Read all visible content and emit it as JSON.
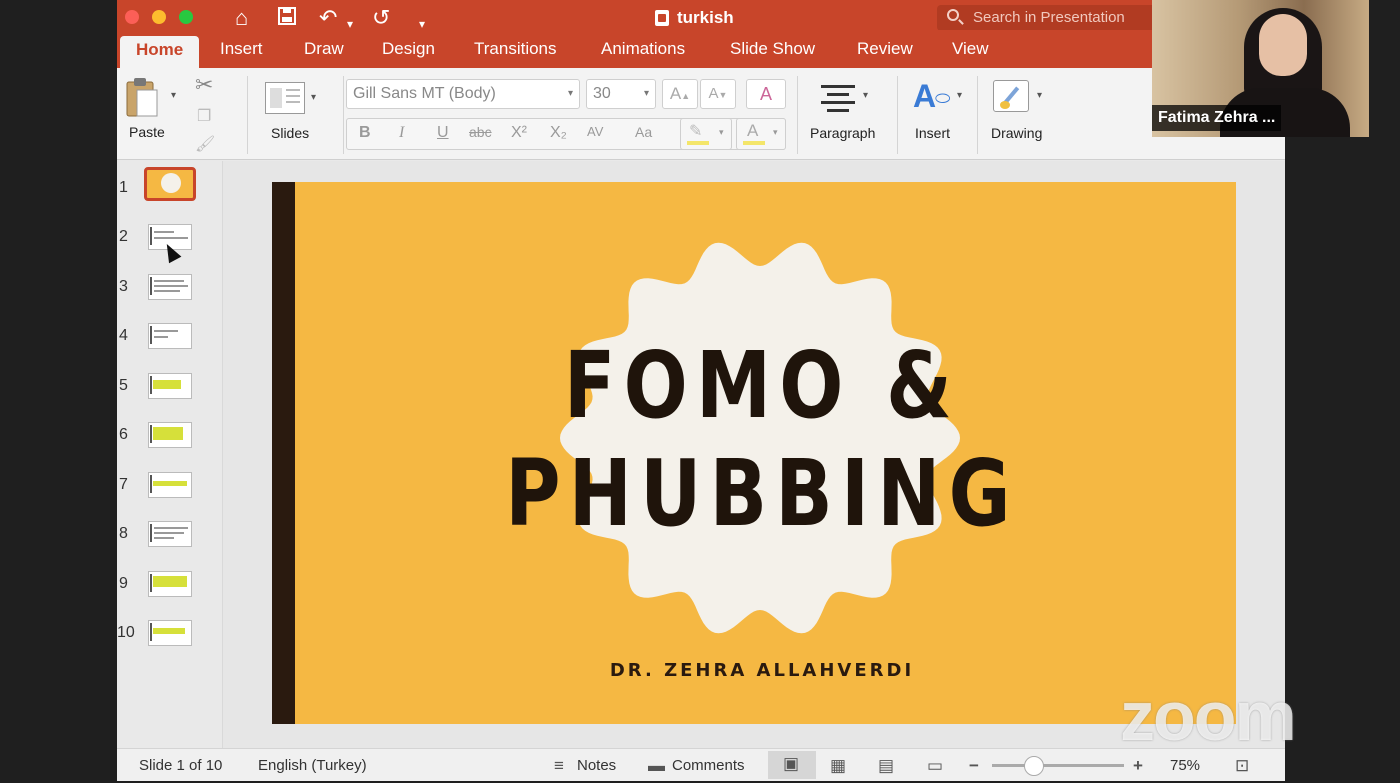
{
  "window": {
    "title": "turkish",
    "search_placeholder": "Search in Presentation",
    "quick_access": [
      "home-icon",
      "save-icon",
      "undo-icon",
      "redo-icon",
      "customize-icon"
    ]
  },
  "tabs": [
    "Home",
    "Insert",
    "Draw",
    "Design",
    "Transitions",
    "Animations",
    "Slide Show",
    "Review",
    "View"
  ],
  "ribbon": {
    "paste_label": "Paste",
    "slides_label": "Slides",
    "font_name": "Gill Sans MT (Body)",
    "font_size": "30",
    "paragraph_label": "Paragraph",
    "insert_label": "Insert",
    "drawing_label": "Drawing",
    "format_buttons": [
      "B",
      "I",
      "U",
      "abc",
      "X²",
      "X₂",
      "AV",
      "Aa",
      "A"
    ]
  },
  "thumbnails": [
    "1",
    "2",
    "3",
    "4",
    "5",
    "6",
    "7",
    "8",
    "9",
    "10"
  ],
  "slide": {
    "title_line1": "FOMO &",
    "title_line2": "PHUBBING",
    "subtitle": "DR. ZEHRA ALLAHVERDI",
    "background_color": "#f5b843",
    "accent_color": "#2a1a0f"
  },
  "status": {
    "slide_counter": "Slide 1 of 10",
    "language": "English (Turkey)",
    "notes_label": "Notes",
    "comments_label": "Comments",
    "zoom_level": "75%",
    "zoom_fraction": 0.32
  },
  "webcam": {
    "participant_name": "Fatima Zehra ..."
  },
  "watermark": "zoom"
}
